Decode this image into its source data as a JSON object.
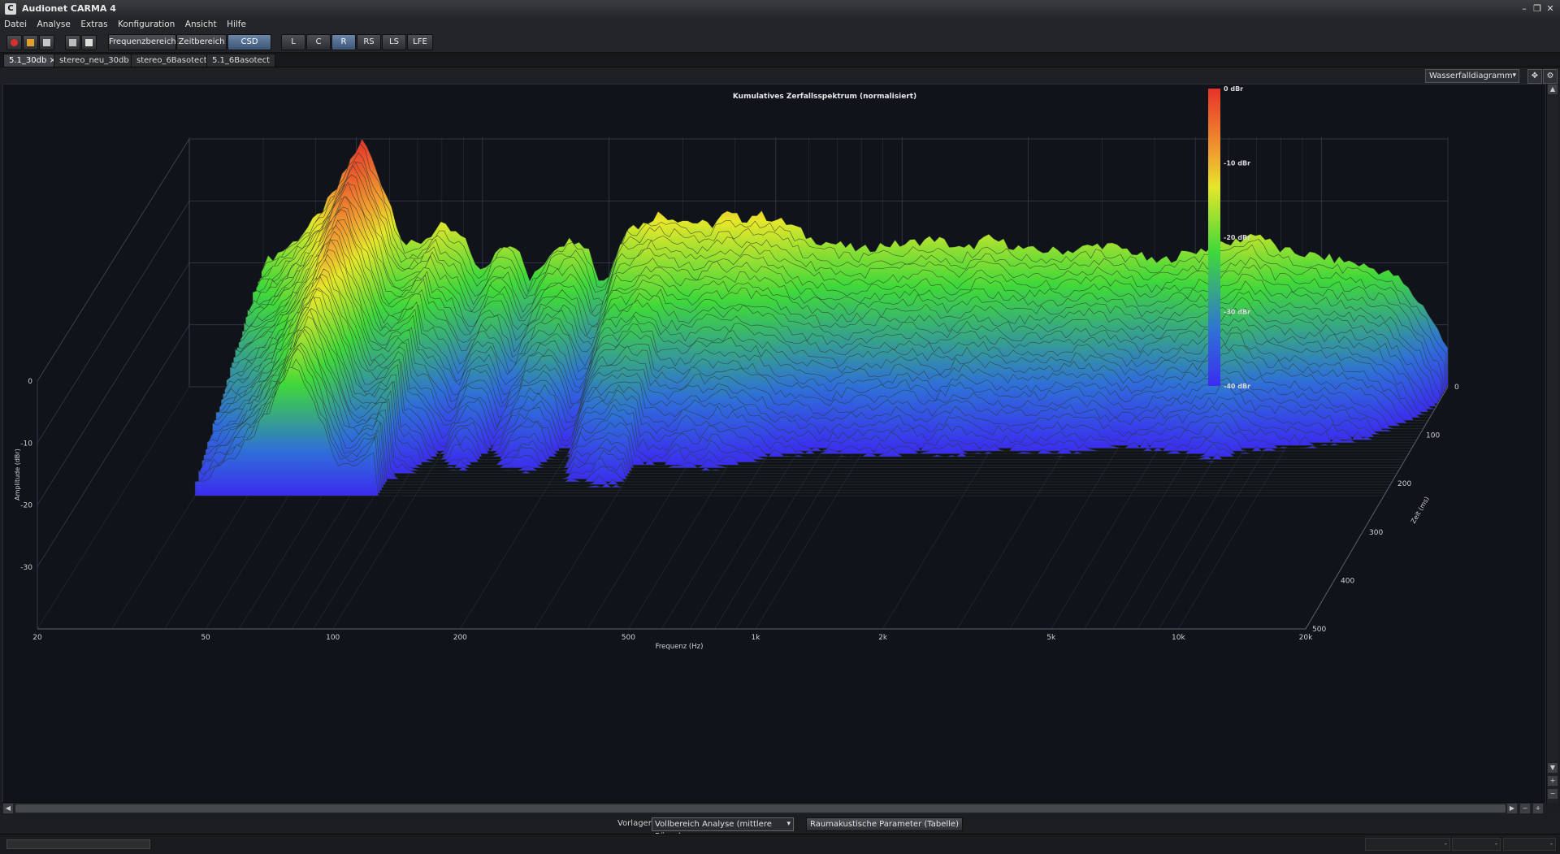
{
  "app": {
    "title": "Audionet CARMA 4",
    "icon_letter": "C"
  },
  "window_controls": [
    "minimize-icon",
    "restore-icon",
    "close-icon"
  ],
  "menu": [
    "Datei",
    "Analyse",
    "Extras",
    "Konfiguration",
    "Ansicht",
    "Hilfe"
  ],
  "toolbar": {
    "icons": [
      "record-icon",
      "open-folder-icon",
      "save-icon",
      "screenshot-icon",
      "print-icon"
    ],
    "views": [
      {
        "label": "Frequenzbereich",
        "active": false
      },
      {
        "label": "Zeitbereich",
        "active": false
      },
      {
        "label": "CSD",
        "active": true
      }
    ],
    "channels": [
      {
        "label": "L",
        "active": false
      },
      {
        "label": "C",
        "active": false
      },
      {
        "label": "R",
        "active": true
      },
      {
        "label": "RS",
        "active": false
      },
      {
        "label": "LS",
        "active": false
      },
      {
        "label": "LFE",
        "active": false
      }
    ]
  },
  "tabs": [
    {
      "label": "5.1_30db",
      "active": true,
      "closable": true
    },
    {
      "label": "stereo_neu_30db",
      "active": false
    },
    {
      "label": "stereo_6Basotect",
      "active": false
    },
    {
      "label": "5.1_6Basotect",
      "active": false
    }
  ],
  "view_selector": {
    "value": "Wasserfalldiagramm"
  },
  "presets": {
    "label": "Vorlagen",
    "value": "Vollbereich Analyse (mittlere Räum)",
    "button": "Raumakustische Parameter (Tabelle)"
  },
  "chart_data": {
    "type": "area",
    "subtype": "3d-waterfall",
    "title": "Kumulatives Zerfallsspektrum (normalisiert)",
    "xlabel": "Frequenz (Hz)",
    "ylabel": "Amplitude (dBr)",
    "zlabel": "Zeit (ms)",
    "x_scale": "log",
    "xlim": [
      20,
      20000
    ],
    "x_ticks": [
      "20",
      "50",
      "100",
      "200",
      "500",
      "1k",
      "2k",
      "5k",
      "10k",
      "20k"
    ],
    "x_tick_values": [
      20,
      50,
      100,
      200,
      500,
      1000,
      2000,
      5000,
      10000,
      20000
    ],
    "ylim": [
      -40,
      0
    ],
    "y_ticks": [
      "0",
      "-10",
      "-20",
      "-30"
    ],
    "z_ticks": [
      "0",
      "100",
      "200",
      "300",
      "400",
      "500"
    ],
    "zlim": [
      0,
      500
    ],
    "colorbar": {
      "labels": [
        "0 dBr",
        "-10 dBr",
        "-20 dBr",
        "-30 dBr",
        "-40 dBr"
      ],
      "colors": [
        "#e8322a",
        "#f0a030",
        "#e6e62a",
        "#3fd83a",
        "#2f6fd8",
        "#3b2cf0"
      ]
    },
    "front_slice": {
      "freqs": [
        30,
        35,
        40,
        45,
        48,
        52,
        55,
        60,
        65,
        70,
        80,
        90,
        100,
        110,
        120,
        130,
        150,
        170,
        180,
        190,
        200,
        220,
        240,
        260,
        300,
        350,
        380,
        420,
        450,
        500,
        550,
        600,
        700,
        800,
        900,
        1000,
        1200,
        1400,
        1600,
        1800,
        2000,
        2500,
        3000,
        3500,
        4000,
        5000,
        6000,
        7000,
        8000,
        10000,
        12000,
        15000,
        18000,
        20000
      ],
      "dbr": [
        -20,
        -17,
        -13,
        -8,
        -4,
        0,
        -4,
        -10,
        -17,
        -17,
        -14,
        -16,
        -22,
        -17,
        -17,
        -23,
        -17,
        -16,
        -18,
        -23,
        -22,
        -14,
        -14,
        -12,
        -13,
        -14,
        -12,
        -13,
        -12,
        -13,
        -14,
        -16,
        -17,
        -18,
        -17,
        -17,
        -16,
        -18,
        -16,
        -17,
        -18,
        -18,
        -17,
        -18,
        -20,
        -18,
        -17,
        -15,
        -18,
        -19,
        -20,
        -22,
        -28,
        -34
      ]
    },
    "decay_slices": 40,
    "grid": true
  }
}
